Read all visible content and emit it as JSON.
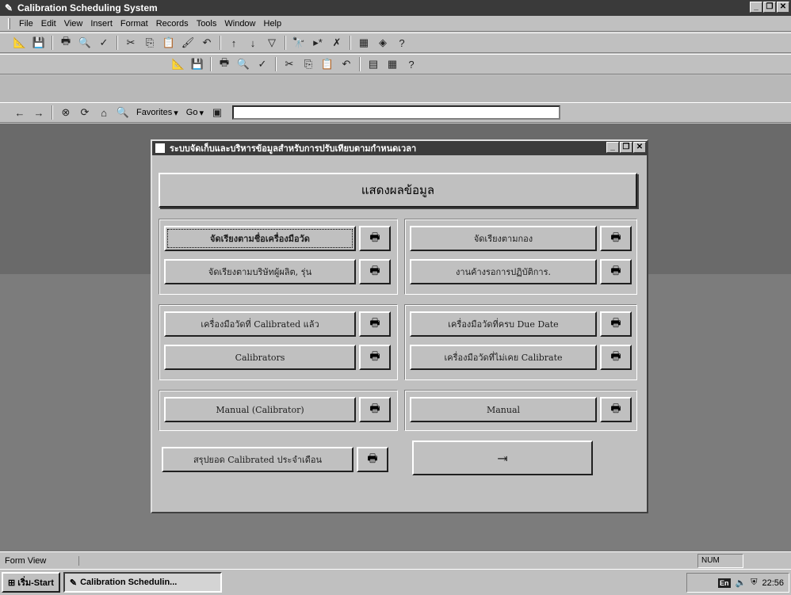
{
  "window": {
    "title": "Calibration Scheduling System",
    "min": "_",
    "max": "❐",
    "close": "✕"
  },
  "menu": [
    "File",
    "Edit",
    "View",
    "Insert",
    "Format",
    "Records",
    "Tools",
    "Window",
    "Help"
  ],
  "browser_toolbar": {
    "favorites": "Favorites",
    "go": "Go",
    "address": ""
  },
  "form": {
    "title": "ระบบจัดเก็บและบริหารข้อมูลสำหรับการปรับเทียบตามกำหนดเวลา",
    "header": "แสดงผลข้อมูล",
    "buttons": {
      "by_name": "จัดเรียงตามชื่อเครื่องมือวัด",
      "by_maker": "จัดเรียงตามบริษัทผู้ผลิต, รุ่น",
      "by_division": "จัดเรียงตามกอง",
      "pending": "งานค้างรอการปฏิบัติการ.",
      "calibrated": "เครื่องมือวัดที่ Calibrated แล้ว",
      "calibrators": "Calibrators",
      "due_date": "เครื่องมือวัดที่ครบ Due Date",
      "never_calibrated": "เครื่องมือวัดที่ไม่เคย Calibrate",
      "manual_calibrator": "Manual (Calibrator)",
      "manual": "Manual",
      "monthly_summary": "สรุปยอด Calibrated ประจำเดือน"
    },
    "print_icon": "🖶",
    "exit_icon": "⇥"
  },
  "status": {
    "mode": "Form View",
    "num": "NUM"
  },
  "taskbar": {
    "start": "เริ่ม-Start",
    "task": "Calibration Schedulin...",
    "time": "22:56",
    "lang": "En"
  }
}
